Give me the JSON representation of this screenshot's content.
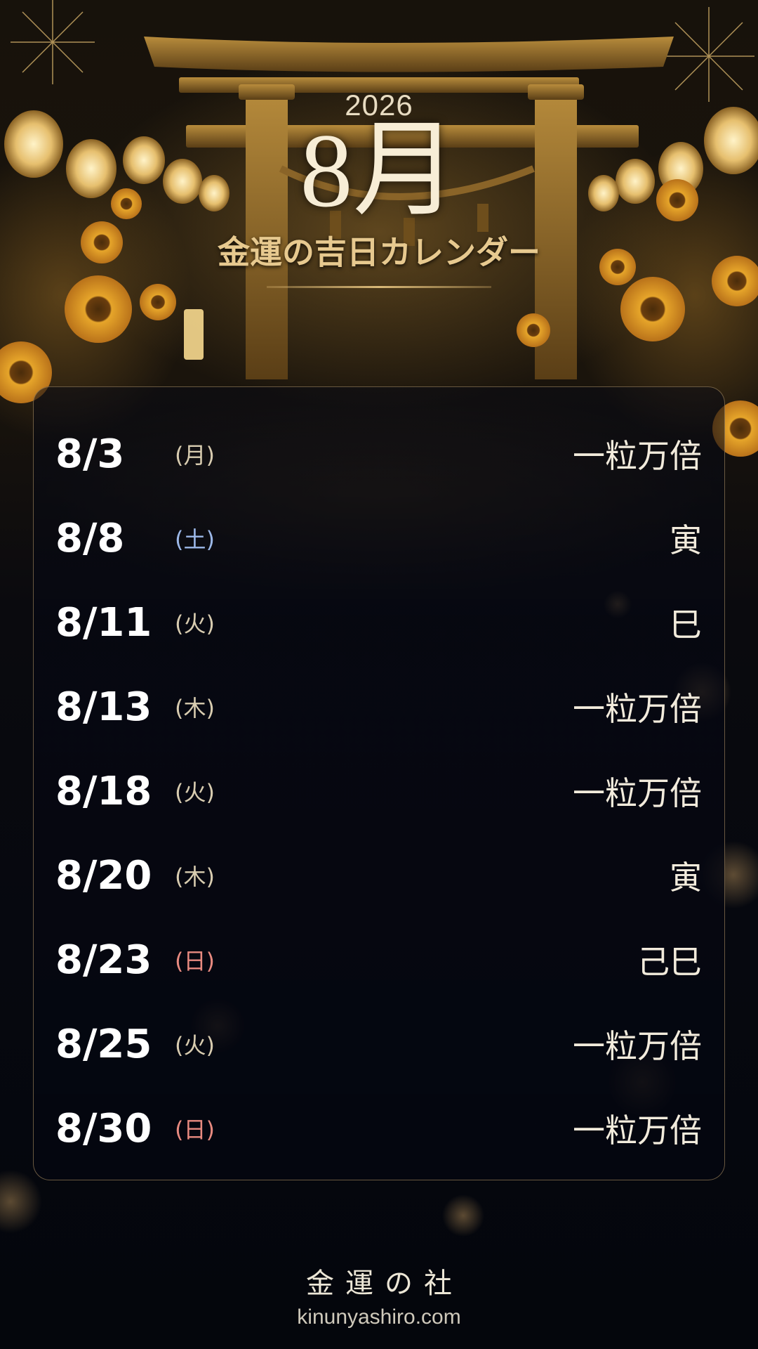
{
  "header": {
    "year": "2026",
    "month": "8月",
    "subtitle": "金運の吉日カレンダー"
  },
  "calendar": {
    "entries": [
      {
        "date": "8/3",
        "weekday": "(月)",
        "weekday_type": "weekday",
        "fortune": "一粒万倍"
      },
      {
        "date": "8/8",
        "weekday": "(土)",
        "weekday_type": "saturday",
        "fortune": "寅"
      },
      {
        "date": "8/11",
        "weekday": "(火)",
        "weekday_type": "weekday",
        "fortune": "巳"
      },
      {
        "date": "8/13",
        "weekday": "(木)",
        "weekday_type": "weekday",
        "fortune": "一粒万倍"
      },
      {
        "date": "8/18",
        "weekday": "(火)",
        "weekday_type": "weekday",
        "fortune": "一粒万倍"
      },
      {
        "date": "8/20",
        "weekday": "(木)",
        "weekday_type": "weekday",
        "fortune": "寅"
      },
      {
        "date": "8/23",
        "weekday": "(日)",
        "weekday_type": "sunday",
        "fortune": "己巳"
      },
      {
        "date": "8/25",
        "weekday": "(火)",
        "weekday_type": "weekday",
        "fortune": "一粒万倍"
      },
      {
        "date": "8/30",
        "weekday": "(日)",
        "weekday_type": "sunday",
        "fortune": "一粒万倍"
      }
    ]
  },
  "footer": {
    "brand": "金運の社",
    "url": "kinunyashiro.com"
  },
  "colors": {
    "gold": "#e7c98f",
    "saturday": "#9cb8e8",
    "sunday": "#e88a80",
    "background": "#05070d"
  },
  "icons": [
    "torii-gate-icon",
    "paper-lantern-icon",
    "sunflower-icon",
    "firework-icon"
  ]
}
